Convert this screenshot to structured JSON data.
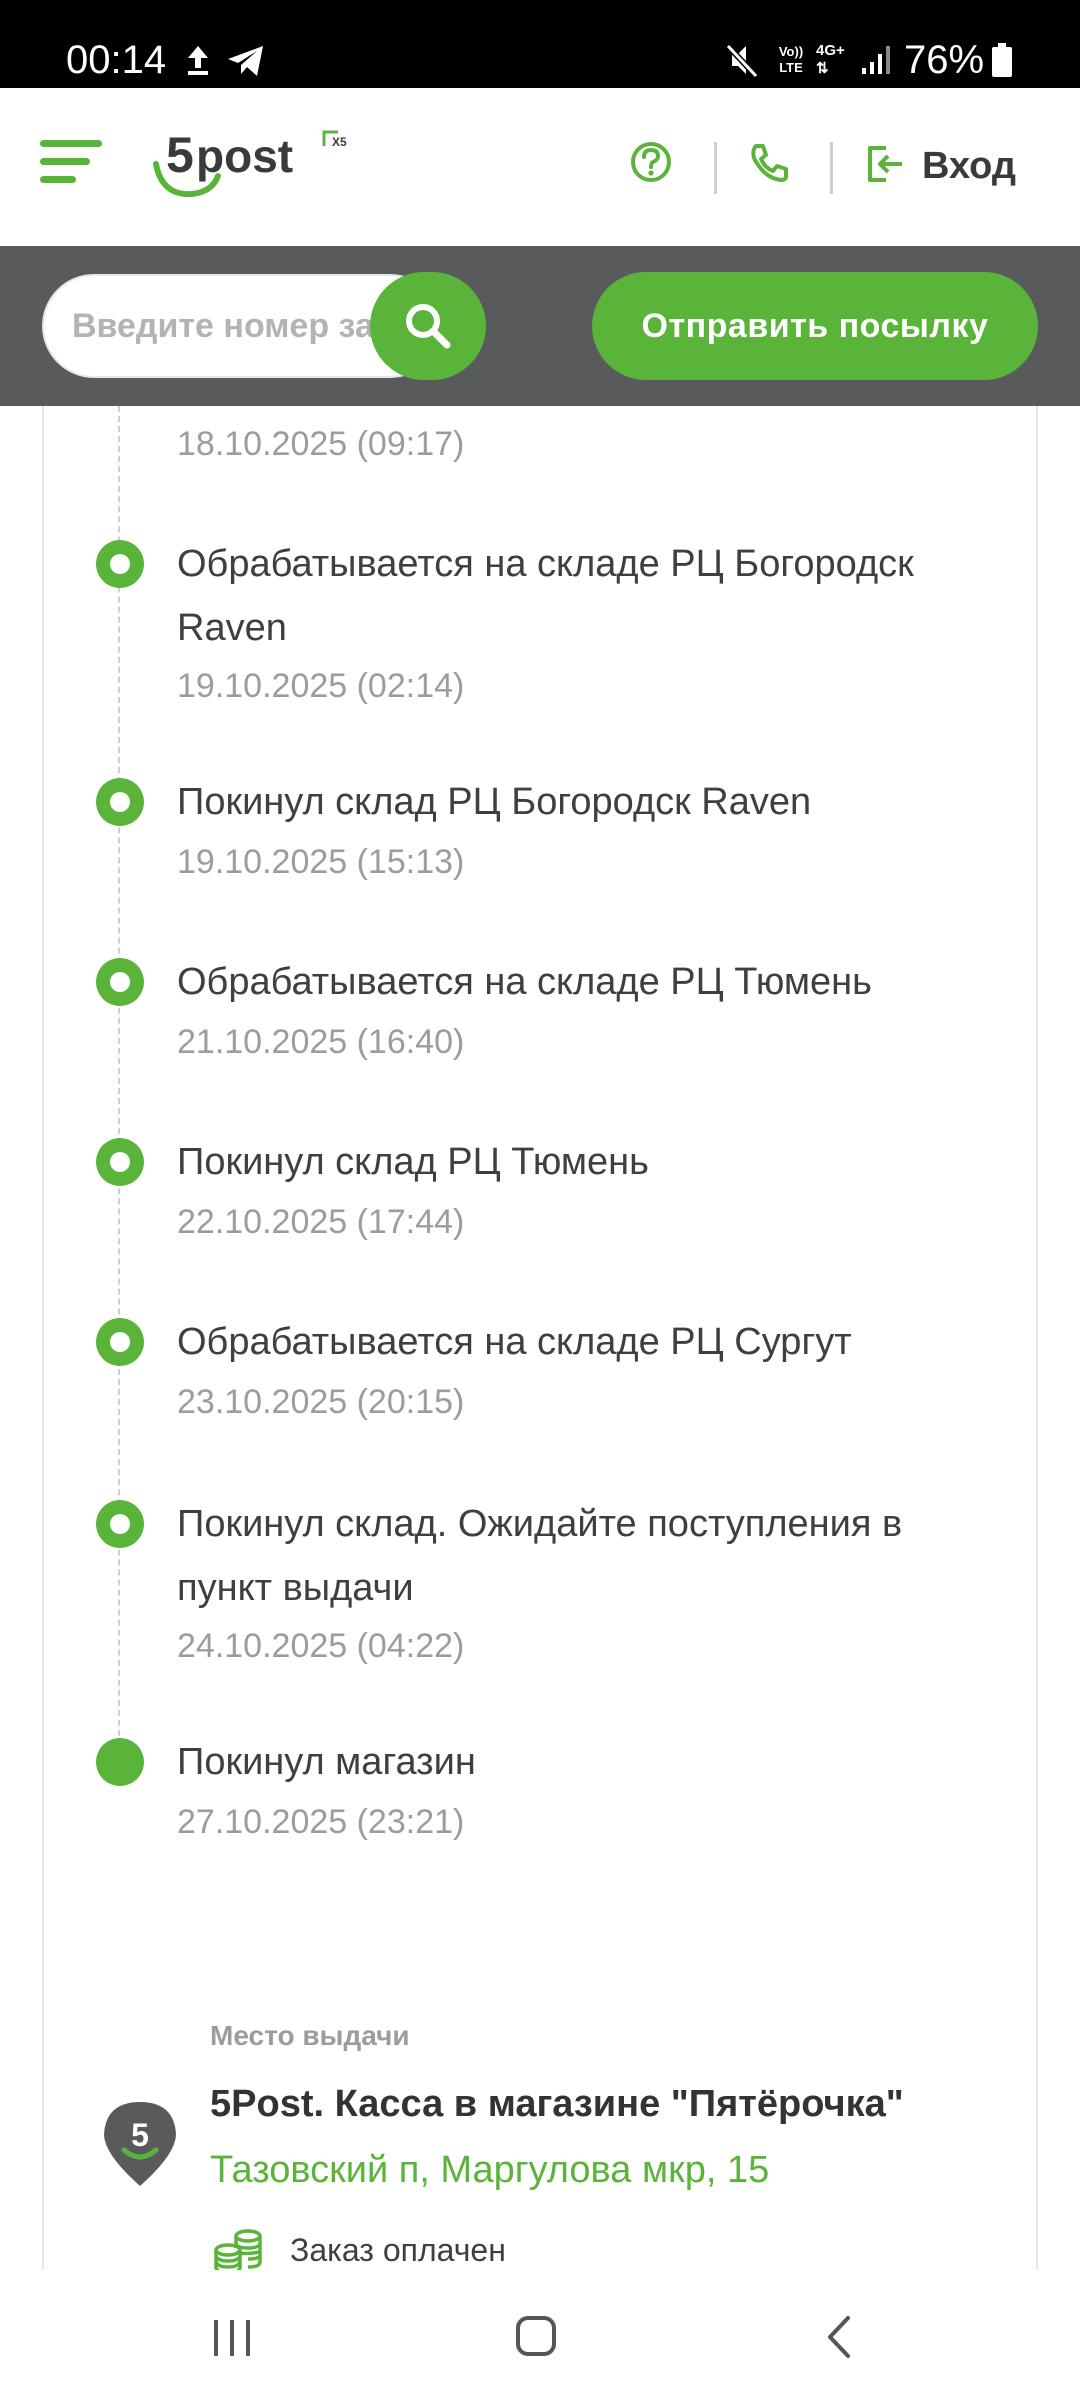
{
  "status_bar": {
    "time": "00:14",
    "battery": "76%",
    "icons": [
      "upload-icon",
      "telegram-icon",
      "mute-icon",
      "volte-icon",
      "4g-icon",
      "signal-icon",
      "battery-icon"
    ],
    "volte_label": "Vo)) LTE",
    "network_label": "4G+"
  },
  "header": {
    "logo_text": "5post",
    "logo_suffix": "X5",
    "login_label": "Вход",
    "icons": [
      "menu-icon",
      "help-icon",
      "phone-icon",
      "login-icon"
    ]
  },
  "search": {
    "placeholder": "Введите номер заказа",
    "send_label": "Отправить посылку"
  },
  "timeline": {
    "partial_date": "18.10.2025 (09:17)",
    "events": [
      {
        "title": "Обрабатывается на складе РЦ Богородск Raven",
        "date": "19.10.2025 (02:14)"
      },
      {
        "title": "Покинул склад РЦ Богородск Raven",
        "date": "19.10.2025 (15:13)"
      },
      {
        "title": "Обрабатывается на складе РЦ Тюмень",
        "date": "21.10.2025 (16:40)"
      },
      {
        "title": "Покинул склад РЦ Тюмень",
        "date": "22.10.2025 (17:44)"
      },
      {
        "title": "Обрабатывается на складе РЦ Сургут",
        "date": "23.10.2025 (20:15)"
      },
      {
        "title": "Покинул склад. Ожидайте поступления в пункт выдачи",
        "date": "24.10.2025 (04:22)"
      },
      {
        "title": "Покинул магазин",
        "date": "27.10.2025 (23:21)"
      }
    ]
  },
  "pickup": {
    "label": "Место выдачи",
    "name": "5Post. Касса в магазине \"Пятёрочка\"",
    "address": "Тазовский п, Маргулова мкр, 15",
    "payment_status": "Заказ оплачен",
    "pin_digit": "5"
  },
  "colors": {
    "accent": "#5ab43a",
    "bar": "#585a5c",
    "muted_text": "#9c9c9c"
  }
}
